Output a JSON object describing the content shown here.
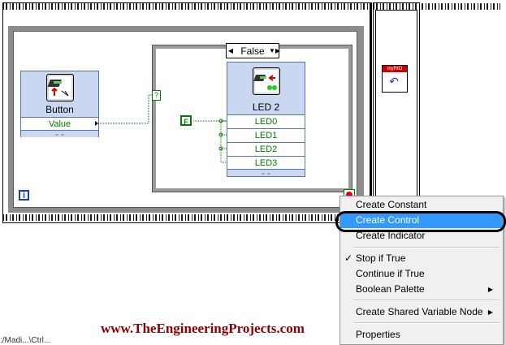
{
  "diagram": {
    "case_selector": "False",
    "button_node": {
      "title": "Button",
      "terminal": "Value"
    },
    "led_node": {
      "title": "LED 2",
      "terminals": [
        "LED0",
        "LED1",
        "LED2",
        "LED3"
      ]
    },
    "bool_constant": "F",
    "tunnel_label": "?",
    "iteration_label": "i",
    "myrio_label": "myRIO"
  },
  "context_menu": {
    "items": [
      {
        "label": "Create Constant",
        "highlighted": false,
        "checked": false,
        "submenu": false
      },
      {
        "label": "Create Control",
        "highlighted": true,
        "checked": false,
        "submenu": false
      },
      {
        "label": "Create Indicator",
        "highlighted": false,
        "checked": false,
        "submenu": false
      },
      {
        "label": "Stop if True",
        "highlighted": false,
        "checked": true,
        "submenu": false
      },
      {
        "label": "Continue if True",
        "highlighted": false,
        "checked": false,
        "submenu": false
      },
      {
        "label": "Boolean Palette",
        "highlighted": false,
        "checked": false,
        "submenu": true
      },
      {
        "label": "Create Shared Variable Node",
        "highlighted": false,
        "checked": false,
        "submenu": true
      },
      {
        "label": "Properties",
        "highlighted": false,
        "checked": false,
        "submenu": false
      }
    ],
    "highlight_color": "#3399ff"
  },
  "watermark": "www.TheEngineeringProjects.com",
  "bottom_left_text": ":/Madi...\\Ctrl...",
  "colors": {
    "wire_bool": "#007a00",
    "node_fill": "#c9d7f0",
    "watermark": "#8b0000"
  }
}
